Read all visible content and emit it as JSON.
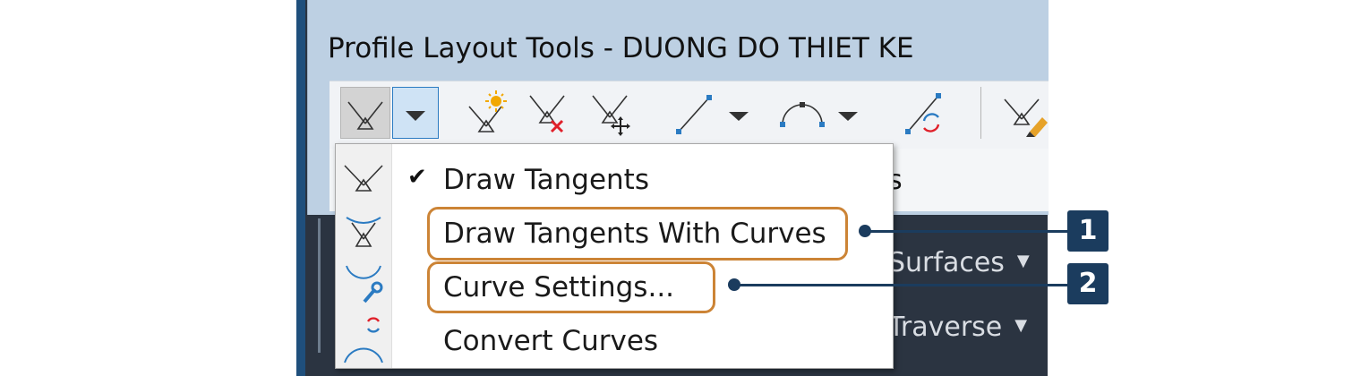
{
  "window": {
    "title": "Profile Layout Tools - DUONG DO THIET KE"
  },
  "toolbar": {
    "buttons": [
      {
        "name": "draw-tangents-icon"
      },
      {
        "name": "dropdown-arrow-icon"
      },
      {
        "name": "insert-pvi-icon"
      },
      {
        "name": "delete-pvi-icon"
      },
      {
        "name": "move-pvi-icon"
      },
      {
        "name": "line-tool-icon"
      },
      {
        "name": "curve-tool-icon"
      },
      {
        "name": "convert-line-curve-icon"
      },
      {
        "name": "edit-pvi-icon"
      }
    ]
  },
  "background": {
    "second_row_peek": "s",
    "surfaces_label": "Surfaces",
    "traverse_label": "Traverse"
  },
  "menu": {
    "items": [
      {
        "label": "Draw Tangents",
        "checked": true,
        "icon": "draw-tangents-icon"
      },
      {
        "label": "Draw Tangents With Curves",
        "checked": false,
        "icon": "draw-tangents-with-curves-icon"
      },
      {
        "label": "Curve Settings...",
        "checked": false,
        "icon": "curve-settings-icon"
      },
      {
        "label": "Convert Curves",
        "checked": false,
        "icon": "convert-curves-icon"
      }
    ],
    "check_glyph": "✔"
  },
  "callouts": [
    {
      "number": "1",
      "target": "Draw Tangents With Curves"
    },
    {
      "number": "2",
      "target": "Curve Settings..."
    }
  ],
  "colors": {
    "highlight": "#cc8436",
    "callout": "#1b3c5e",
    "title_bar": "#bdd0e3",
    "dark_panel": "#2b3441"
  }
}
